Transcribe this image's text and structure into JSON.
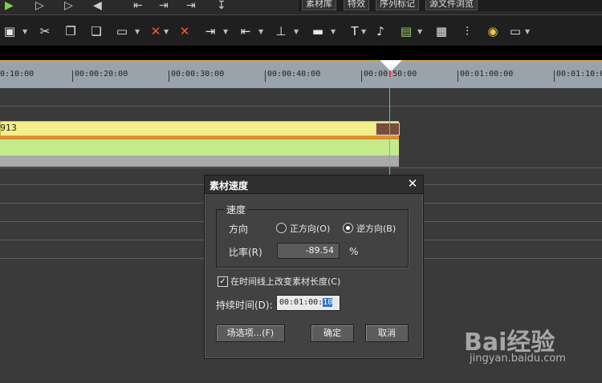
{
  "top_tabs": [
    "素材库",
    "特效",
    "序列标记",
    "源文件浏览"
  ],
  "toolbar": {
    "icons": [
      "save-icon",
      "cut-icon",
      "copy-icon",
      "paste-icon",
      "clip-icon",
      "delete-icon",
      "ripple-delete-icon",
      "set-in-icon",
      "set-out-icon",
      "split-icon",
      "audio-mix-icon",
      "title-icon",
      "mic-icon",
      "render-icon",
      "grid-icon",
      "mixer-icon",
      "color-icon",
      "display-icon"
    ]
  },
  "ruler": {
    "labels": [
      "0:10:00",
      "00:00:20:00",
      "00:00:30:00",
      "00:00:40:00",
      "00:00:50:00",
      "00:01:00:00",
      "00:01:10:0"
    ]
  },
  "clip": {
    "label": "913",
    "colors": {
      "video": "#f4ee8c",
      "audio": "#c5ea8b",
      "stripe": "#e08a2e"
    }
  },
  "dialog": {
    "title": "素材速度",
    "group_label": "速度",
    "direction_label": "方向",
    "forward_label": "正方向(O)",
    "reverse_label": "逆方向(B)",
    "selected_direction": "reverse",
    "rate_label": "比率(R)",
    "rate_value": "-89.54",
    "rate_unit": "%",
    "change_length_label": "在时间线上改变素材长度(C)",
    "change_length_checked": true,
    "duration_label": "持续时间(D):",
    "duration_prefix": "00:01:00:",
    "duration_selected": "10",
    "buttons": {
      "field_options": "场选项...(F)",
      "ok": "确定",
      "cancel": "取消"
    }
  },
  "watermark": {
    "line1": "Bai经验",
    "line2": "jingyan.baidu.com"
  }
}
